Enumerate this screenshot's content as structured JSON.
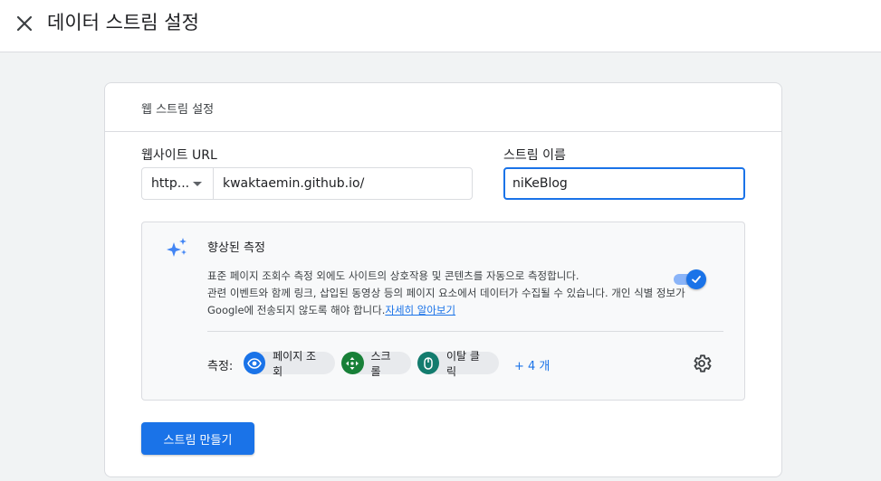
{
  "header": {
    "title": "데이터 스트림 설정",
    "close_icon": "close-icon"
  },
  "card": {
    "title": "웹 스트림 설정"
  },
  "form": {
    "url_label": "웹사이트 URL",
    "protocol_value": "http...",
    "url_value": "kwaktaemin.github.io/",
    "name_label": "스트림 이름",
    "name_value": "niKeBlog"
  },
  "enhanced": {
    "title": "향상된 측정",
    "desc_line1": "표준 페이지 조회수 측정 외에도 사이트의 상호작용 및 콘텐츠를 자동으로 측정합니다.",
    "desc_line2": "관련 이벤트와 함께 링크, 삽입된 동영상 등의 페이지 요소에서 데이터가 수집될 수 있습니다. 개인 식별 정보가 Google에 전송되지 않도록 해야 합니다.",
    "learn_more": "자세히 알아보기",
    "toggle_on": true,
    "measure_label": "측정:",
    "chips": [
      {
        "label": "페이지 조회",
        "icon": "eye-icon",
        "color": "#1a73e8"
      },
      {
        "label": "스크롤",
        "icon": "scroll-arrows-icon",
        "color": "#188038"
      },
      {
        "label": "이탈 클릭",
        "icon": "mouse-icon",
        "color": "#137c6e"
      }
    ],
    "more": "+ 4 개"
  },
  "actions": {
    "create_label": "스트림 만들기"
  },
  "colors": {
    "accent": "#1a73e8",
    "background": "#f1f3f4"
  }
}
